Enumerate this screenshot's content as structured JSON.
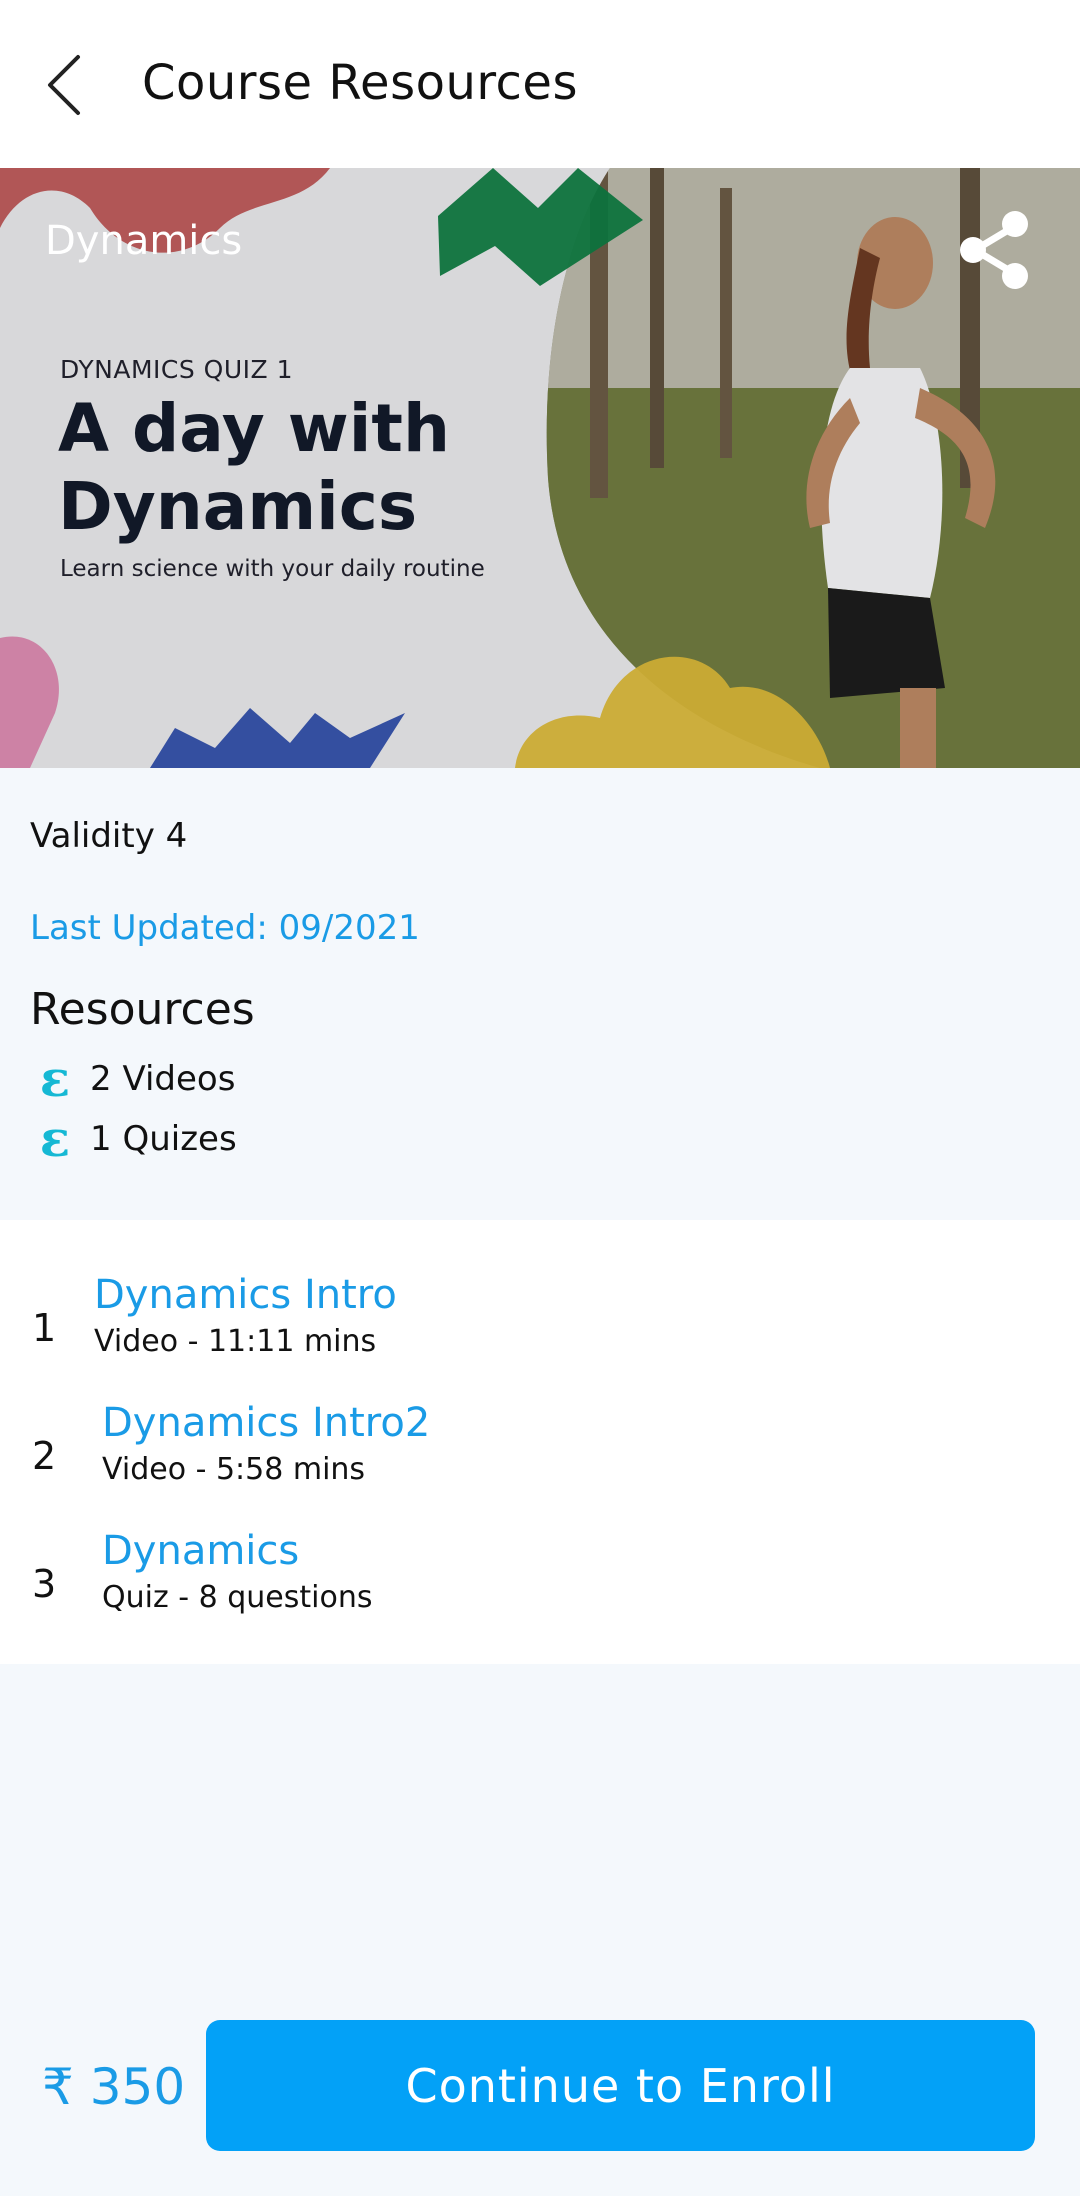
{
  "header": {
    "title": "Course Resources"
  },
  "banner": {
    "course_name": "Dynamics",
    "quiz_label": "DYNAMICS QUIZ 1",
    "headline_line1": "A day with",
    "headline_line2": "Dynamics",
    "tagline": "Learn science with your daily routine"
  },
  "info": {
    "validity": "Validity 4",
    "last_updated": "Last Updated: 09/2021",
    "resources_heading": "Resources",
    "resources": [
      {
        "icon": "resource-glyph-icon",
        "label": "2 Videos"
      },
      {
        "icon": "resource-glyph-icon",
        "label": "1 Quizes"
      }
    ]
  },
  "lessons": [
    {
      "number": "1",
      "title": "Dynamics Intro",
      "meta": "Video - 11:11 mins"
    },
    {
      "number": "2",
      "title": "Dynamics Intro2",
      "meta": "Video - 5:58 mins"
    },
    {
      "number": "3",
      "title": "Dynamics",
      "meta": "Quiz - 8 questions"
    }
  ],
  "footer": {
    "price": "₹ 350",
    "enroll_label": "Continue to Enroll"
  },
  "colors": {
    "accent": "#1a9be6",
    "button": "#03a1f7",
    "resource_icon": "#15b8d4",
    "background": "#f4f8fc"
  }
}
